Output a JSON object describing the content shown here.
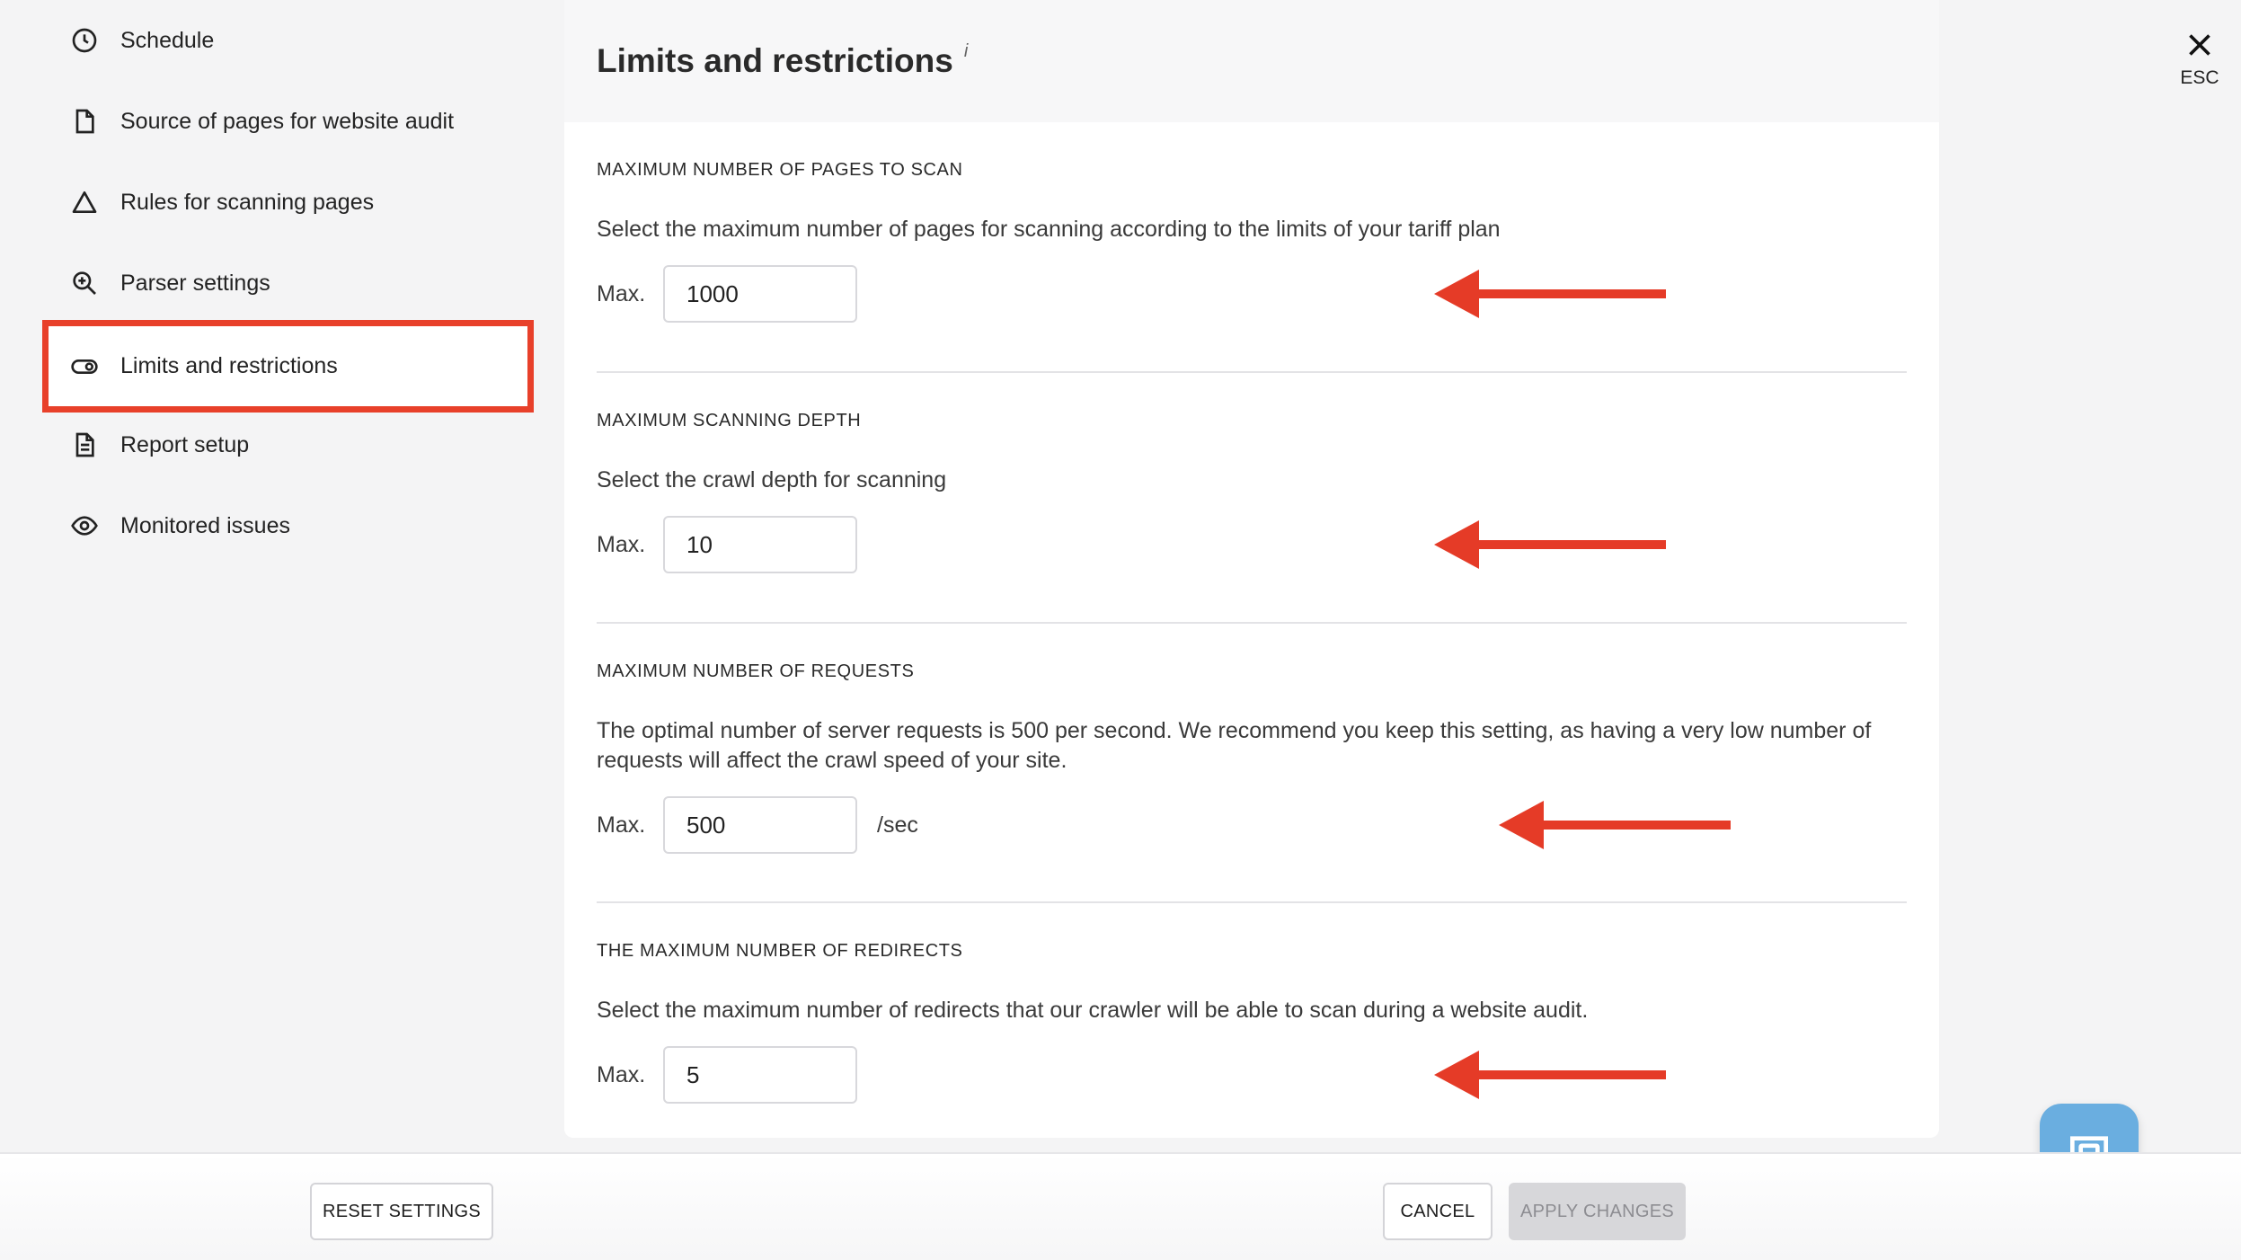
{
  "sidebar": {
    "items": [
      {
        "label": "Schedule",
        "icon": "clock-icon"
      },
      {
        "label": "Source of pages for website audit",
        "icon": "file-icon"
      },
      {
        "label": "Rules for scanning pages",
        "icon": "triangle-icon"
      },
      {
        "label": "Parser settings",
        "icon": "zoom-icon"
      },
      {
        "label": "Limits and restrictions",
        "icon": "toggle-icon",
        "active": true
      },
      {
        "label": "Report setup",
        "icon": "document-icon"
      },
      {
        "label": "Monitored issues",
        "icon": "eye-icon"
      }
    ]
  },
  "panel": {
    "title": "Limits and restrictions",
    "info": "i",
    "sections": [
      {
        "title": "MAXIMUM NUMBER OF PAGES TO SCAN",
        "description": "Select the maximum number of pages for scanning according to the limits of your tariff plan",
        "max_label": "Max.",
        "value": "1000"
      },
      {
        "title": "MAXIMUM SCANNING DEPTH",
        "description": "Select the crawl depth for scanning",
        "max_label": "Max.",
        "value": "10"
      },
      {
        "title": "MAXIMUM NUMBER OF REQUESTS",
        "description": "The optimal number of server requests is 500 per second. We recommend you keep this setting, as having a very low number of requests will affect the crawl speed of your site.",
        "max_label": "Max.",
        "value": "500",
        "unit": "/sec"
      },
      {
        "title": "THE MAXIMUM NUMBER OF REDIRECTS",
        "description": "Select the maximum number of redirects that our crawler will be able to scan during a website audit.",
        "max_label": "Max.",
        "value": "5"
      }
    ]
  },
  "close": {
    "label": "ESC"
  },
  "footer": {
    "reset_label": "RESET SETTINGS",
    "cancel_label": "CANCEL",
    "apply_label": "APPLY CHANGES"
  },
  "colors": {
    "highlight": "#e8402a",
    "arrow": "#e53b27",
    "chat": "#6aaee0"
  }
}
